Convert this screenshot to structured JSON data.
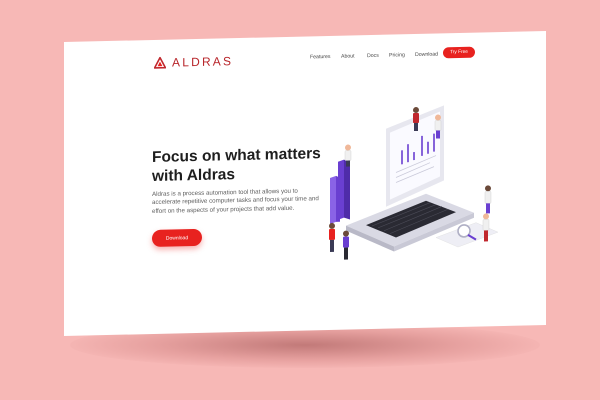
{
  "brand": {
    "name": "ALDRAS",
    "accent": "#e8221f",
    "logo_color": "#b8262b"
  },
  "nav": {
    "items": [
      {
        "label": "Features"
      },
      {
        "label": "About"
      },
      {
        "label": "Docs"
      },
      {
        "label": "Pricing"
      },
      {
        "label": "Download"
      }
    ],
    "cta_label": "Try Free"
  },
  "hero": {
    "title": "Focus on what matters with Aldras",
    "description": "Aldras is a process automation tool that allows you to accelerate repetitive computer tasks and focus your time and effort on the aspects of your projects that add value.",
    "button_label": "Download"
  },
  "illustration": {
    "icon": "isometric-laptop-team-illustration"
  },
  "colors": {
    "background": "#f7b8b6",
    "page": "#ffffff",
    "heading": "#1e1e1e",
    "body_text": "#5e5e5e",
    "purple": "#6a3fd1"
  }
}
